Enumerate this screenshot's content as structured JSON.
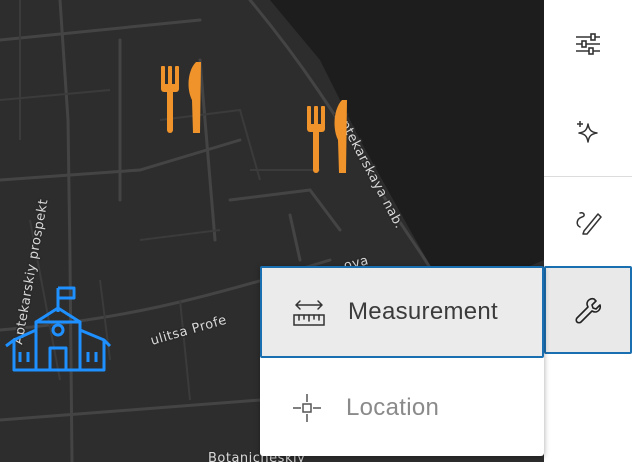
{
  "map": {
    "streets": [
      "Aptekarskiy prospekt",
      "Aptekarskaya nab.",
      "ulitsa Profe",
      "ova",
      "Botanicheskiy"
    ],
    "poi": [
      {
        "name": "restaurant-icon",
        "color": "#f0932b"
      },
      {
        "name": "restaurant-icon",
        "color": "#f0932b"
      },
      {
        "name": "school-icon",
        "color": "#1e90ff"
      }
    ]
  },
  "toolbar": {
    "items": [
      {
        "name": "filter-sliders-icon",
        "label": "Filters"
      },
      {
        "name": "sparkle-icon",
        "label": "Effects"
      },
      {
        "name": "sketch-pencil-icon",
        "label": "Sketch"
      },
      {
        "name": "wrench-icon",
        "label": "Tools",
        "active": true
      }
    ]
  },
  "popup": {
    "items": [
      {
        "label": "Measurement",
        "icon": "ruler-measure-icon",
        "active": true
      },
      {
        "label": "Location",
        "icon": "crosshair-location-icon",
        "disabled": true
      }
    ]
  },
  "colors": {
    "map_bg": "#2b2b2b",
    "water": "#1c1c1c",
    "accent_border": "#1a6fb0",
    "restaurant": "#f0932b",
    "school": "#1e90ff"
  }
}
